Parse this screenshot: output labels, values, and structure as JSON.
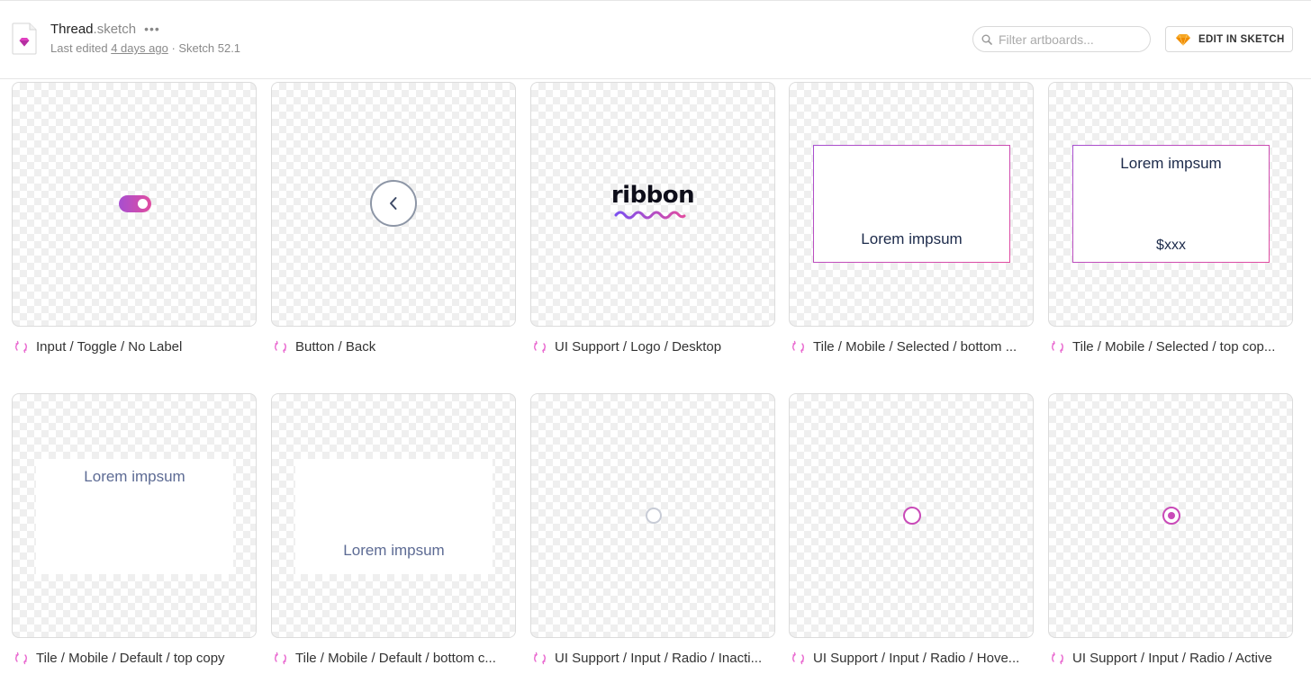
{
  "header": {
    "file_name": "Thread",
    "file_ext": ".sketch",
    "more_label": "•••",
    "last_edited_prefix": "Last edited ",
    "last_edited_ago": "4 days ago",
    "version_text": " · Sketch 52.1",
    "search_placeholder": "Filter artboards...",
    "edit_button_label": "EDIT IN SKETCH"
  },
  "artboards": [
    {
      "label": "Input / Toggle / No Label",
      "preview": "toggle"
    },
    {
      "label": "Button / Back",
      "preview": "back-button"
    },
    {
      "label": "UI Support / Logo / Desktop",
      "preview": "logo",
      "logo_text": "ribbon"
    },
    {
      "label": "Tile / Mobile / Selected / bottom ...",
      "preview": "tile-selected-bottom",
      "tile_text": "Lorem impsum"
    },
    {
      "label": "Tile / Mobile / Selected / top cop...",
      "preview": "tile-selected-top",
      "tile_text": "Lorem impsum",
      "tile_price": "$xxx"
    },
    {
      "label": "Tile / Mobile / Default / top copy",
      "preview": "tile-default-top",
      "tile_text": "Lorem impsum"
    },
    {
      "label": "Tile / Mobile / Default / bottom c...",
      "preview": "tile-default-bottom",
      "tile_text": "Lorem impsum"
    },
    {
      "label": "UI Support / Input / Radio / Inacti...",
      "preview": "radio-inactive"
    },
    {
      "label": "UI Support / Input / Radio / Hove...",
      "preview": "radio-hover"
    },
    {
      "label": "UI Support / Input / Radio / Active",
      "preview": "radio-active"
    }
  ],
  "colors": {
    "accent_purple": "#a74fd0",
    "accent_pink": "#e14ba0",
    "radio_hover": "#c94ab8",
    "sketch_orange": "#f6a623"
  },
  "icons": {
    "file": "sketch-file-icon",
    "search": "search-icon",
    "edit": "sketch-diamond-icon",
    "caption": "symbol-icon"
  }
}
